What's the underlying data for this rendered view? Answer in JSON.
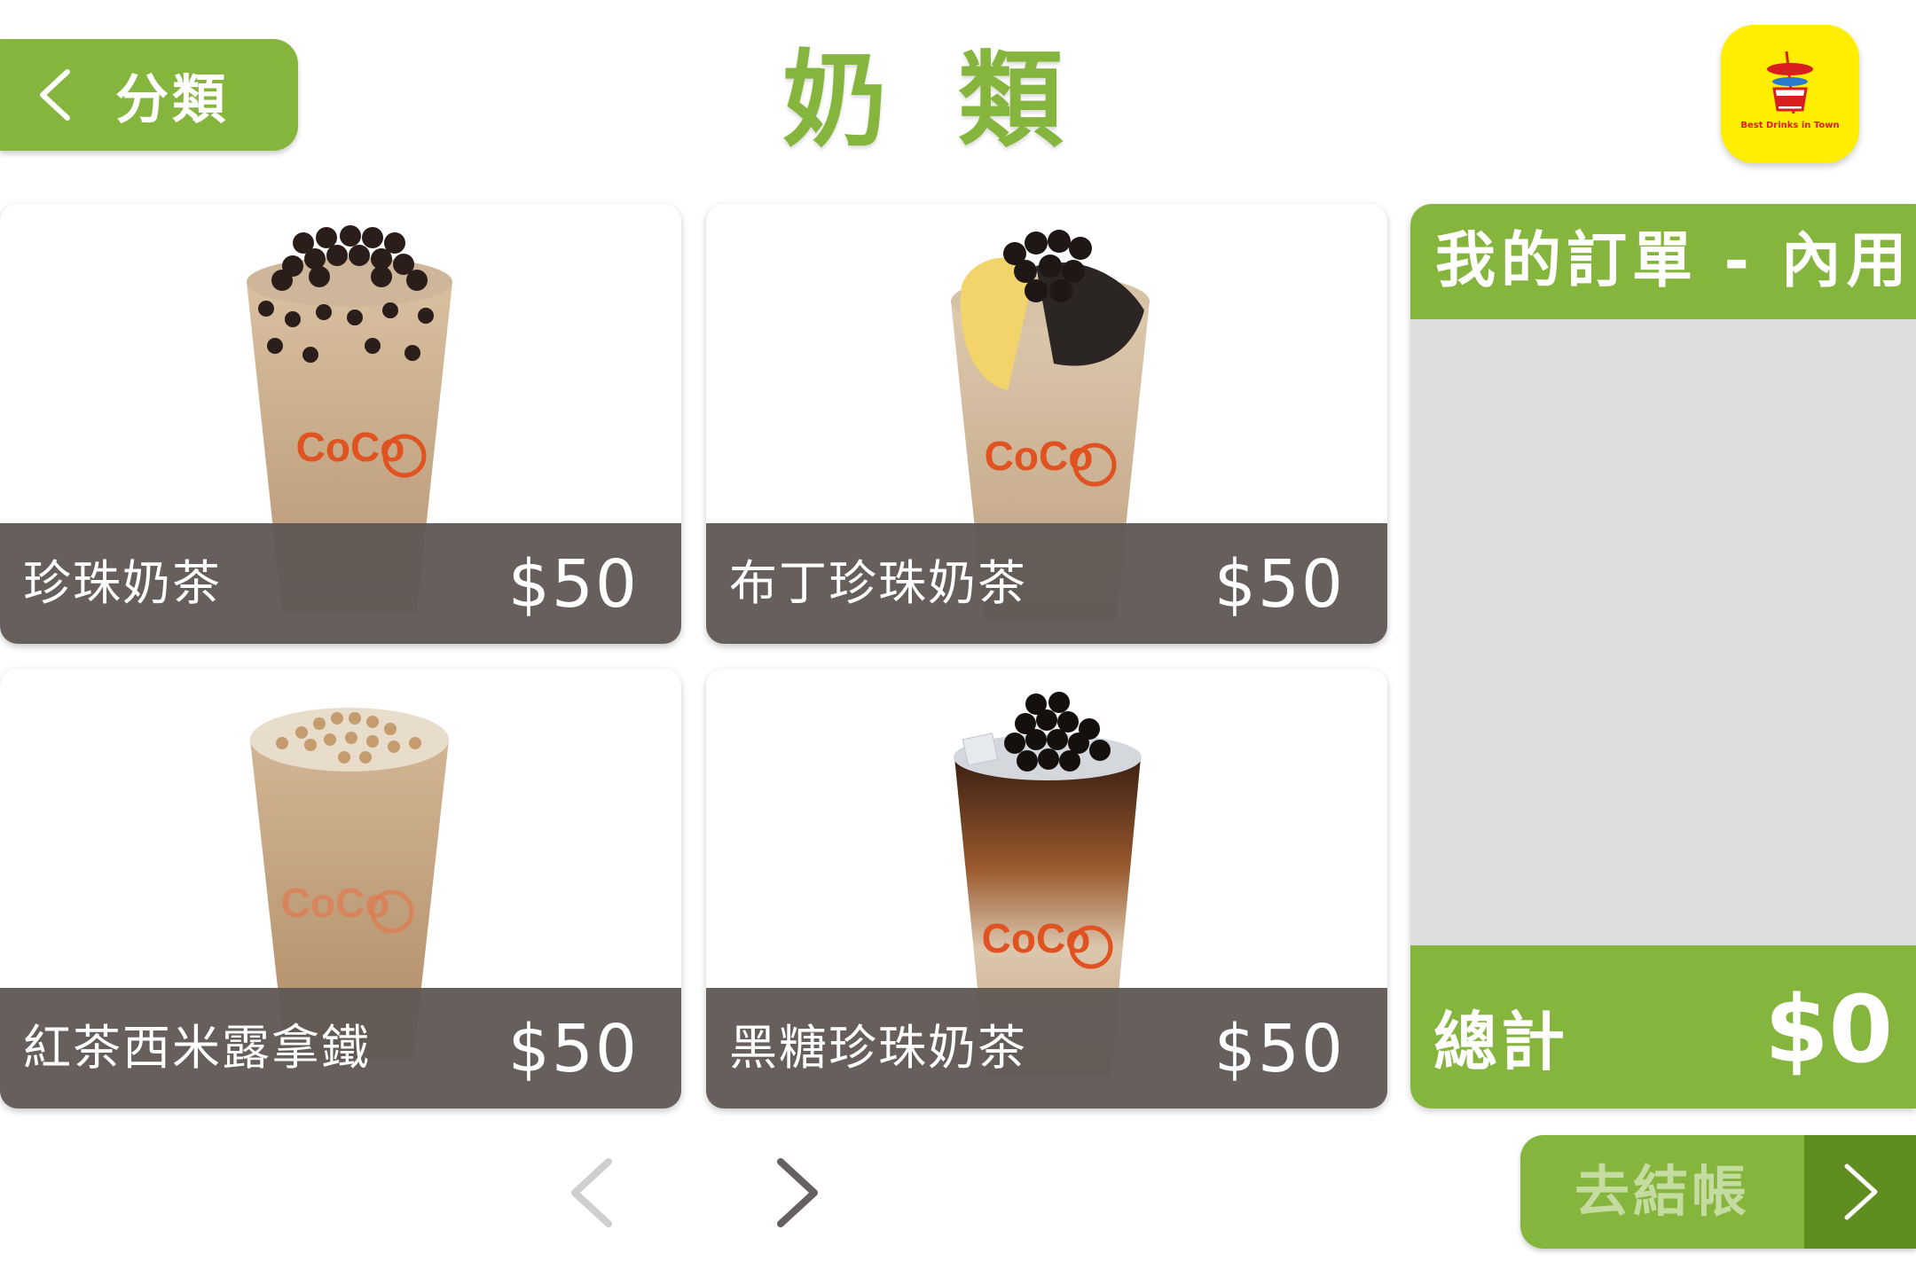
{
  "header": {
    "back_label": "分類",
    "title": "奶類",
    "logo_text": "Best Drinks in Town"
  },
  "products": [
    {
      "name": "珍珠奶茶",
      "price": "$50",
      "topping": "pearl"
    },
    {
      "name": "布丁珍珠奶茶",
      "price": "$50",
      "topping": "pudding"
    },
    {
      "name": "紅茶西米露拿鐵",
      "price": "$50",
      "topping": "sago"
    },
    {
      "name": "黑糖珍珠奶茶",
      "price": "$50",
      "topping": "brown-sugar"
    }
  ],
  "order": {
    "title": "我的訂單 - 內用",
    "total_label": "總計",
    "total_value": "$0"
  },
  "checkout": {
    "label": "去結帳"
  },
  "colors": {
    "accent": "#86b53e",
    "accent_dark": "#5f8d1f",
    "card_bar": "#605855",
    "order_bg": "#dddddd",
    "logo_bg": "#ffee00"
  },
  "icons": {
    "back": "chevron-left-icon",
    "prev": "chevron-left-icon",
    "next": "chevron-right-icon",
    "checkout": "chevron-right-icon"
  }
}
